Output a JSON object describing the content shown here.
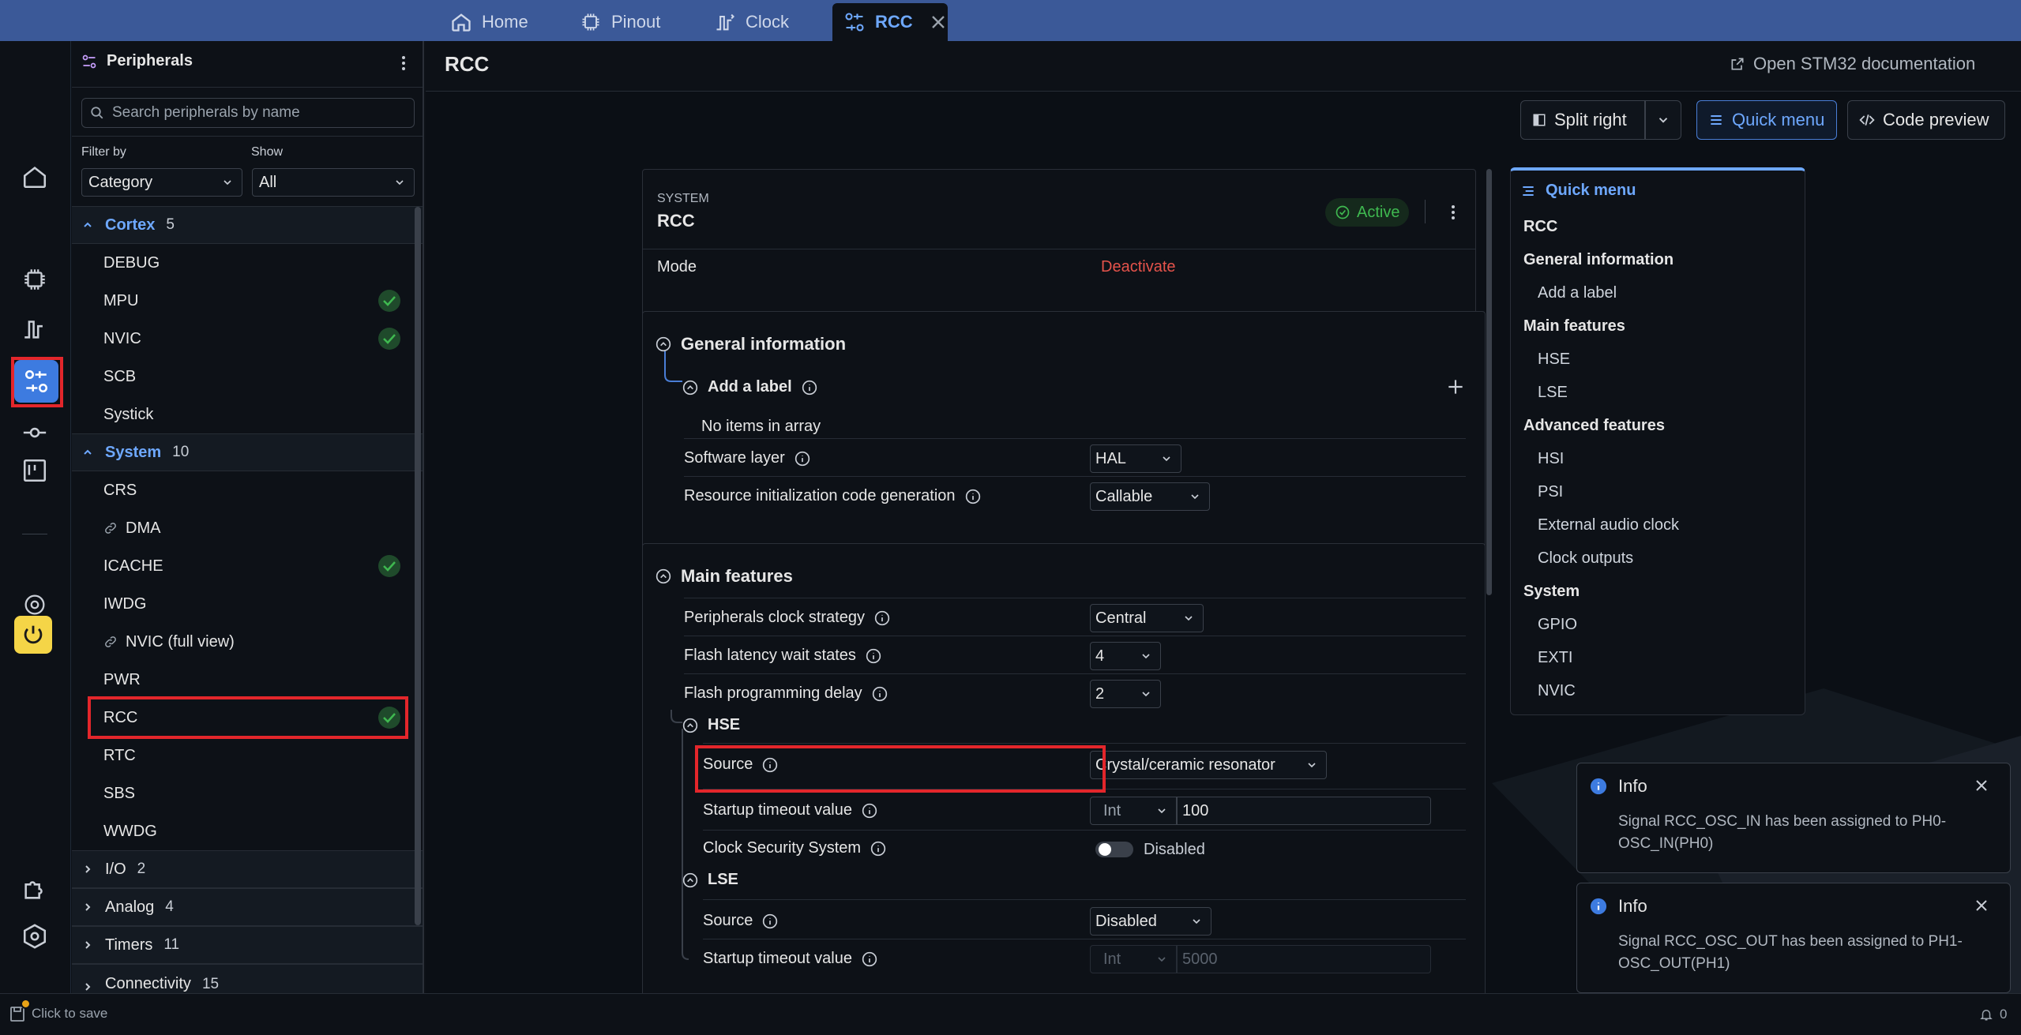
{
  "tabs": [
    {
      "label": "Home",
      "icon": "home-icon"
    },
    {
      "label": "Pinout",
      "icon": "chip-icon"
    },
    {
      "label": "Clock",
      "icon": "clock-waveform-icon"
    },
    {
      "label": "RCC",
      "icon": "peripherals-icon",
      "active": true
    }
  ],
  "rail": {
    "icons": [
      "home-icon",
      "chip-icon",
      "clock-waveform-icon",
      "peripherals-icon",
      "node-icon",
      "board-icon",
      "settings-gear-icon",
      "power-icon",
      "puzzle-icon",
      "hexagon-icon"
    ]
  },
  "peripherals": {
    "title": "Peripherals",
    "search_placeholder": "Search peripherals by name",
    "filter_label": "Filter by",
    "filter_value": "Category",
    "show_label": "Show",
    "show_value": "All",
    "categories": [
      {
        "name": "Cortex",
        "count": "5",
        "expanded": true,
        "items": [
          {
            "name": "DEBUG",
            "active": false
          },
          {
            "name": "MPU",
            "active": true
          },
          {
            "name": "NVIC",
            "active": true
          },
          {
            "name": "SCB",
            "active": false
          },
          {
            "name": "Systick",
            "active": false
          }
        ]
      },
      {
        "name": "System",
        "count": "10",
        "expanded": true,
        "items": [
          {
            "name": "CRS",
            "active": false
          },
          {
            "name": "DMA",
            "active": false,
            "linked": true
          },
          {
            "name": "ICACHE",
            "active": true
          },
          {
            "name": "IWDG",
            "active": false
          },
          {
            "name": "NVIC (full view)",
            "active": false,
            "linked": true
          },
          {
            "name": "PWR",
            "active": false
          },
          {
            "name": "RCC",
            "active": true,
            "selected": true
          },
          {
            "name": "RTC",
            "active": false
          },
          {
            "name": "SBS",
            "active": false
          },
          {
            "name": "WWDG",
            "active": false
          }
        ]
      },
      {
        "name": "I/O",
        "count": "2",
        "expanded": false
      },
      {
        "name": "Analog",
        "count": "4",
        "expanded": false
      },
      {
        "name": "Timers",
        "count": "11",
        "expanded": false
      },
      {
        "name": "Connectivity",
        "count": "15",
        "expanded": false
      }
    ]
  },
  "main": {
    "title": "RCC",
    "doc_link": "Open STM32 documentation",
    "split_label": "Split right",
    "quick_menu_label": "Quick menu",
    "code_preview_label": "Code preview",
    "header_card": {
      "group": "SYSTEM",
      "name": "RCC",
      "status": "Active",
      "mode_label": "Mode",
      "mode_action": "Deactivate"
    },
    "general": {
      "title": "General information",
      "add_label": "Add a label",
      "empty_text": "No items in array",
      "software_layer_label": "Software layer",
      "software_layer_value": "HAL",
      "resource_label": "Resource initialization code generation",
      "resource_value": "Callable"
    },
    "features": {
      "title": "Main features",
      "clock_strategy_label": "Peripherals clock strategy",
      "clock_strategy_value": "Central",
      "flash_latency_label": "Flash latency wait states",
      "flash_latency_value": "4",
      "flash_prog_label": "Flash programming delay",
      "flash_prog_value": "2",
      "hse": {
        "title": "HSE",
        "source_label": "Source",
        "source_value": "Crystal/ceramic resonator",
        "timeout_label": "Startup timeout value",
        "timeout_type": "Int",
        "timeout_value": "100",
        "css_label": "Clock Security System",
        "css_value": "Disabled"
      },
      "lse": {
        "title": "LSE",
        "source_label": "Source",
        "source_value": "Disabled",
        "timeout_label": "Startup timeout value",
        "timeout_type": "Int",
        "timeout_value": "5000"
      }
    }
  },
  "quick_menu": {
    "title": "Quick menu",
    "entries": [
      {
        "label": "RCC",
        "bold": true
      },
      {
        "label": "General information",
        "bold": true
      },
      {
        "label": "Add a label",
        "bold": false
      },
      {
        "label": "Main features",
        "bold": true
      },
      {
        "label": "HSE",
        "bold": false
      },
      {
        "label": "LSE",
        "bold": false
      },
      {
        "label": "Advanced features",
        "bold": true
      },
      {
        "label": "HSI",
        "bold": false
      },
      {
        "label": "PSI",
        "bold": false
      },
      {
        "label": "External audio clock",
        "bold": false
      },
      {
        "label": "Clock outputs",
        "bold": false
      },
      {
        "label": "System",
        "bold": true
      },
      {
        "label": "GPIO",
        "bold": false
      },
      {
        "label": "EXTI",
        "bold": false
      },
      {
        "label": "NVIC",
        "bold": false
      }
    ]
  },
  "toasts": [
    {
      "title": "Info",
      "message": "Signal RCC_OSC_IN has been assigned to PH0-OSC_IN(PH0)"
    },
    {
      "title": "Info",
      "message": "Signal RCC_OSC_OUT has been assigned to PH1-OSC_OUT(PH1)"
    }
  ],
  "status_bar": {
    "save_label": "Click to save",
    "notification_count": "0"
  },
  "colors": {
    "accent": "#6ea8fe",
    "active_green": "#3fb950",
    "deactivate_red": "#e5534b",
    "highlight_red": "#e3262b",
    "tab_bar": "#3b5998",
    "warning_yellow": "#f5d547"
  }
}
